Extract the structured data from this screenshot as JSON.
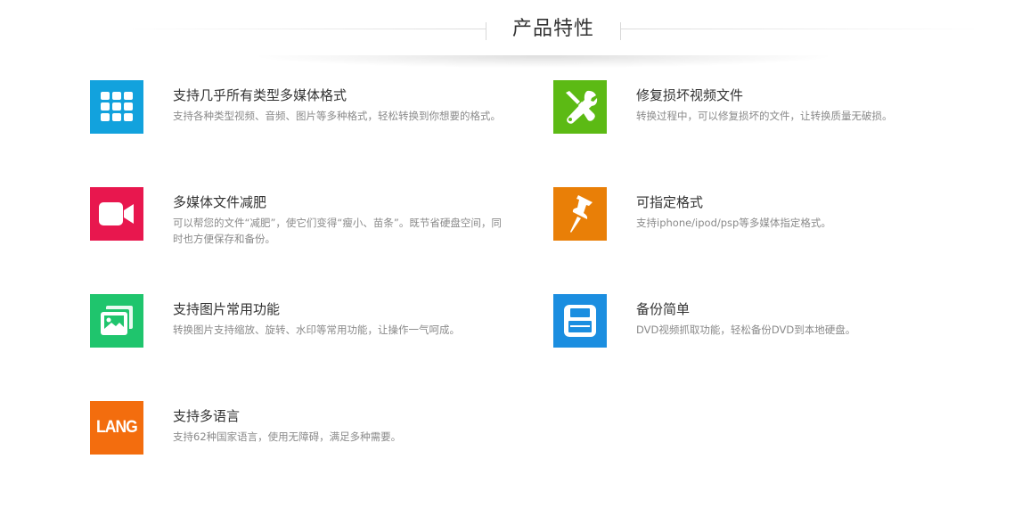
{
  "header": {
    "title": "产品特性"
  },
  "colors": {
    "blue": "#12a2dd",
    "green": "#5cba14",
    "pink": "#e8174e",
    "orange": "#e97f07",
    "teal_green": "#1fc56d",
    "save_blue": "#1b8ee0",
    "lang_orange": "#f36d0e"
  },
  "features": [
    {
      "icon": "grid-icon",
      "title": "支持几乎所有类型多媒体格式",
      "desc": "支持各种类型视频、音频、图片等多种格式，轻松转换到你想要的格式。"
    },
    {
      "icon": "tools-icon",
      "title": "修复损坏视频文件",
      "desc": "转换过程中，可以修复损坏的文件，让转换质量无破损。"
    },
    {
      "icon": "video-camera-icon",
      "title": "多媒体文件减肥",
      "desc": "可以帮您的文件“减肥”，使它们变得“瘦小、苗条”。既节省硬盘空间，同时也方便保存和备份。"
    },
    {
      "icon": "pushpin-icon",
      "title": "可指定格式",
      "desc": "支持iphone/ipod/psp等多媒体指定格式。"
    },
    {
      "icon": "picture-icon",
      "title": "支持图片常用功能",
      "desc": "转换图片支持缩放、旋转、水印等常用功能，让操作一气呵成。"
    },
    {
      "icon": "floppy-disk-icon",
      "title": "备份简单",
      "desc": "DVD视频抓取功能，轻松备份DVD到本地硬盘。"
    },
    {
      "icon": "lang-icon",
      "icon_text": "LANG",
      "title": "支持多语言",
      "desc": "支持62种国家语言，使用无障碍，满足多种需要。"
    }
  ]
}
